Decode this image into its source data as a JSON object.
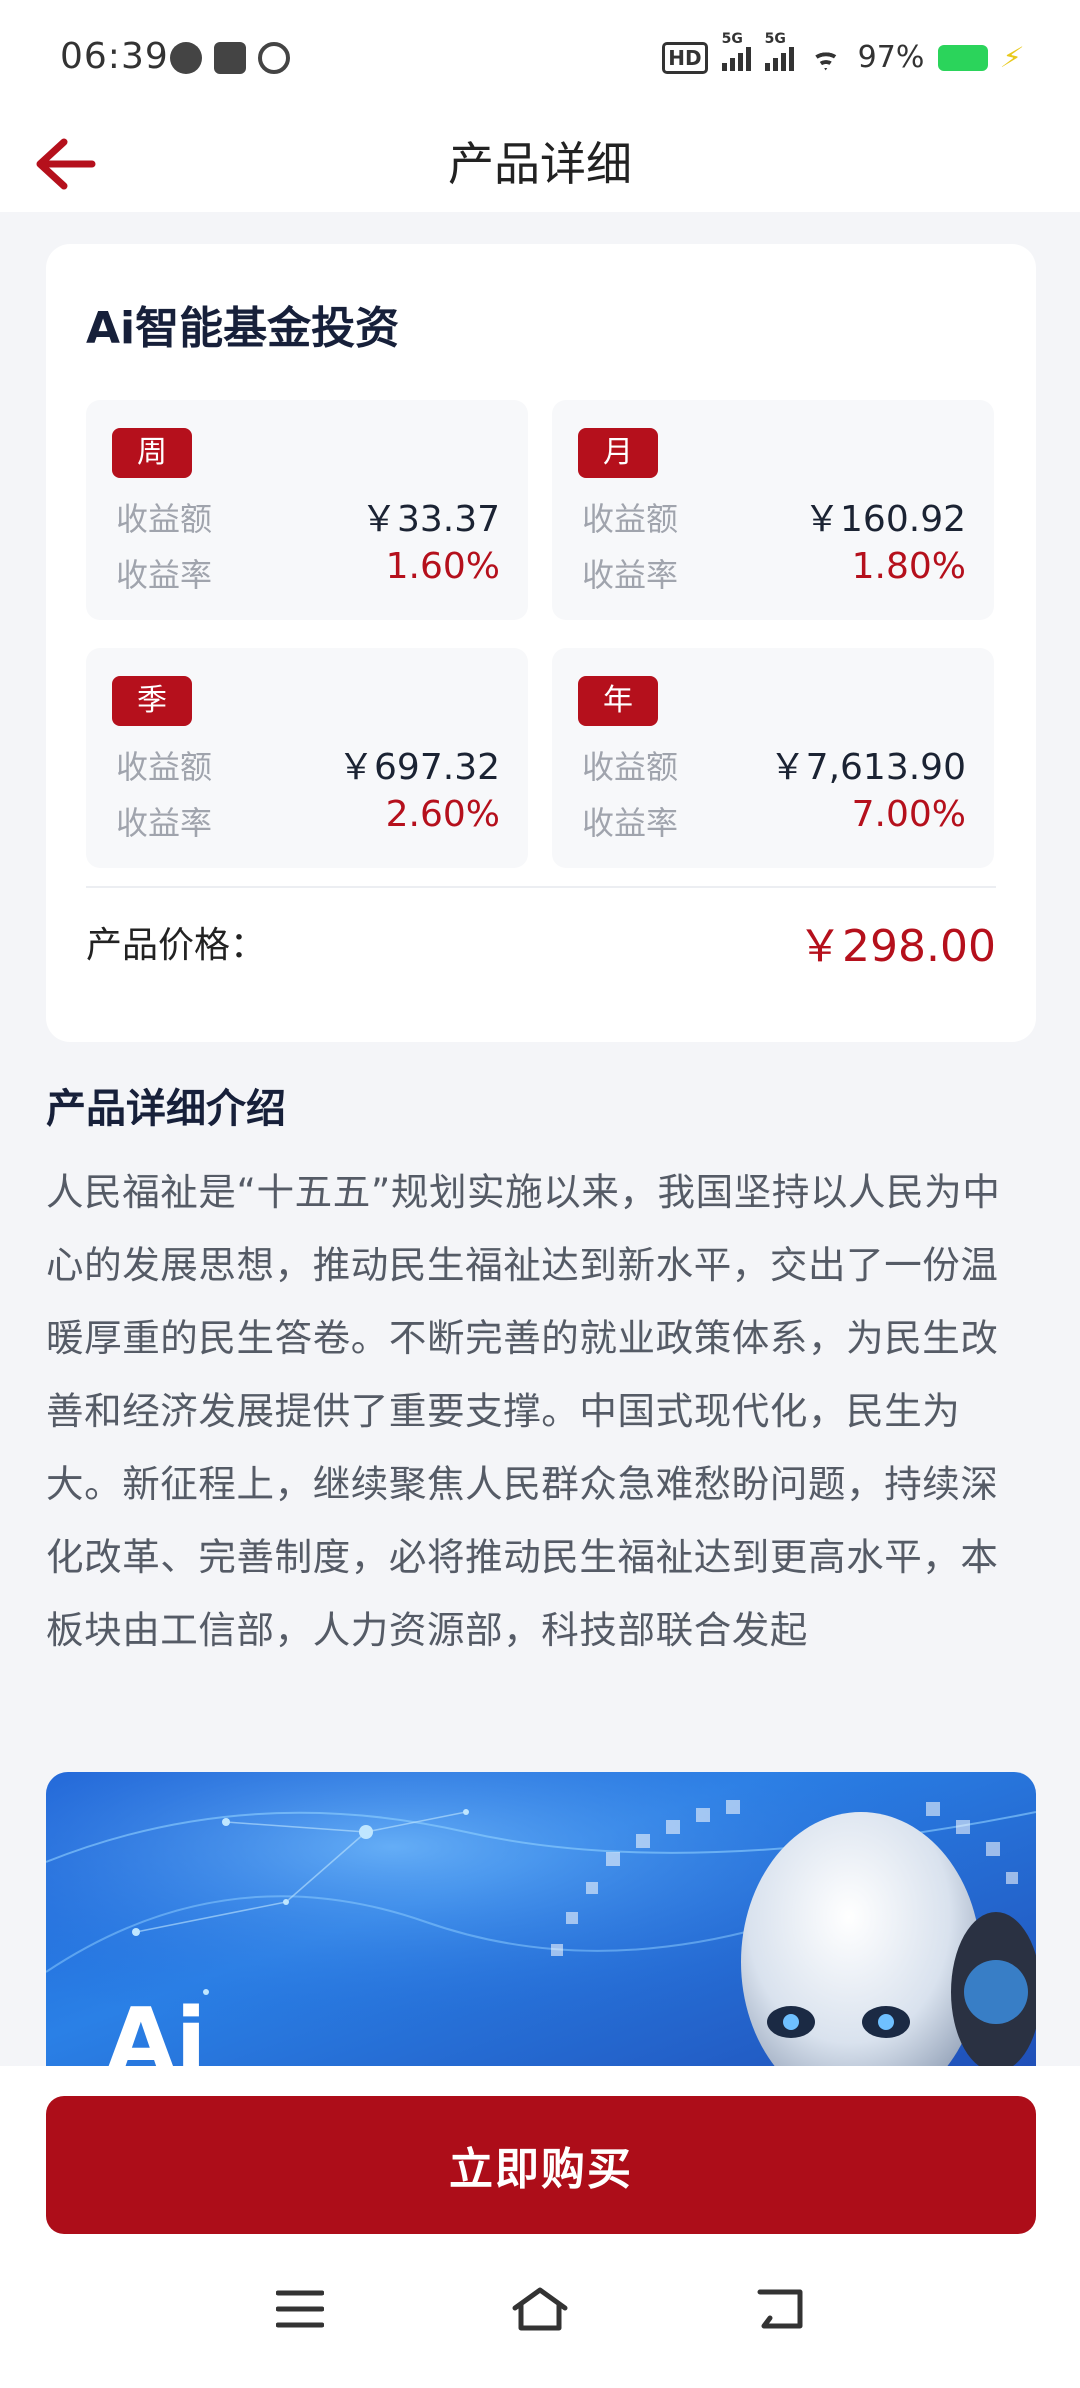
{
  "status_bar": {
    "time": "06:39",
    "hd_label": "HD",
    "signal1_label": "5G",
    "signal2_label": "5G",
    "battery_percent": "97%",
    "battery_level": 0.97
  },
  "header": {
    "title": "产品详细"
  },
  "product": {
    "name": "Ai智能基金投资",
    "periods": [
      {
        "tag": "周",
        "amount_label": "收益额",
        "amount": "￥33.37",
        "rate_label": "收益率",
        "rate": "1.60%"
      },
      {
        "tag": "月",
        "amount_label": "收益额",
        "amount": "￥160.92",
        "rate_label": "收益率",
        "rate": "1.80%"
      },
      {
        "tag": "季",
        "amount_label": "收益额",
        "amount": "￥697.32",
        "rate_label": "收益率",
        "rate": "2.60%"
      },
      {
        "tag": "年",
        "amount_label": "收益额",
        "amount": "￥7,613.90",
        "rate_label": "收益率",
        "rate": "7.00%"
      }
    ],
    "price_label": "产品价格：",
    "price": "￥298.00"
  },
  "details": {
    "title": "产品详细介绍",
    "text": "人民福祉是“十五五”规划实施以来，我国坚持以人民为中心的发展思想，推动民生福祉达到新水平，交出了一份温暖厚重的民生答卷。不断完善的就业政策体系，为民生改善和经济发展提供了重要支撑。中国式现代化，民生为大。新征程上，继续聚焦人民群众急难愁盼问题，持续深化改革、完善制度，必将推动民生福祉达到更高水平，本板块由工信部，人力资源部，科技部联合发起"
  },
  "banner": {
    "text": "Ai"
  },
  "actions": {
    "buy_label": "立即购买"
  },
  "colors": {
    "accent": "#b5101c",
    "button": "#ad0d19"
  }
}
